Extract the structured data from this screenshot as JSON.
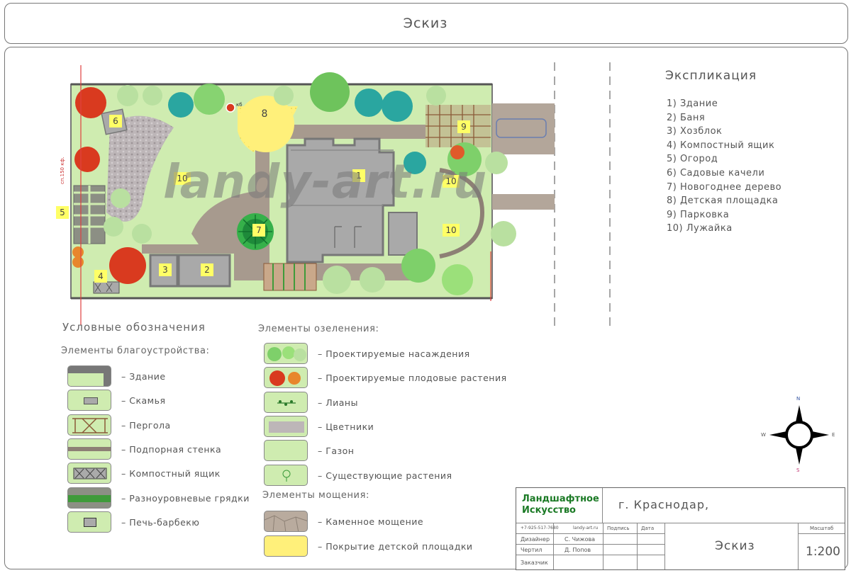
{
  "sheet": {
    "title": "Эскиз"
  },
  "explication": {
    "title": "Экспликация",
    "items": [
      "1) Здание",
      "2) Баня",
      "3) Хозблок",
      "4) Компостный ящик",
      "5) Огород",
      "6) Садовые качели",
      "7) Новогоднее дерево",
      "8) Детская площадка",
      "9) Парковка",
      "10) Лужайка"
    ]
  },
  "plan": {
    "watermark": "landy-art.ru",
    "zone_numbers": [
      "1",
      "2",
      "3",
      "4",
      "5",
      "6",
      "7",
      "8",
      "9",
      "10",
      "10",
      "10"
    ],
    "side_note": "сп.150 кф.",
    "tree_note": "кб"
  },
  "legend": {
    "title": "Условные обозначения",
    "improvement": {
      "title": "Элементы благоустройства:",
      "items": [
        {
          "label": "– Здание",
          "icon": "building-swatch"
        },
        {
          "label": "– Скамья",
          "icon": "bench-swatch"
        },
        {
          "label": "– Пергола",
          "icon": "pergola-swatch"
        },
        {
          "label": "– Подпорная стенка",
          "icon": "retaining-wall-swatch"
        },
        {
          "label": "– Компостный ящик",
          "icon": "compost-box-swatch"
        },
        {
          "label": "– Разноуровневые грядки",
          "icon": "raised-beds-swatch"
        },
        {
          "label": "– Печь-барбекю",
          "icon": "bbq-oven-swatch"
        }
      ]
    },
    "greening": {
      "title": "Элементы озеленения:",
      "items": [
        {
          "label": "– Проектируемые насаждения",
          "icon": "planned-plants-swatch"
        },
        {
          "label": "– Проектируемые плодовые растения",
          "icon": "fruit-plants-swatch"
        },
        {
          "label": "– Лианы",
          "icon": "vines-swatch"
        },
        {
          "label": "– Цветники",
          "icon": "flowerbeds-swatch"
        },
        {
          "label": "– Газон",
          "icon": "lawn-swatch"
        },
        {
          "label": "– Существующие растения",
          "icon": "existing-plants-swatch"
        }
      ]
    },
    "paving": {
      "title": "Элементы мощения:",
      "items": [
        {
          "label": "– Каменное мощение",
          "icon": "stone-paving-swatch"
        },
        {
          "label": "– Покрытие детской площадки",
          "icon": "playground-surface-swatch"
        }
      ]
    }
  },
  "compass": {
    "n": "N",
    "s": "S",
    "e": "E",
    "w": "W"
  },
  "stamp": {
    "logo_line1": "Ландшафтное",
    "logo_line2": "Искусство",
    "city": "г. Краснодар,",
    "phone": "+7-925-517-7680",
    "site": "landy-art.ru",
    "col_signature": "Подпись",
    "col_date": "Дата",
    "col_scale": "Масштаб",
    "designer_role": "Дизайнер",
    "designer_name": "С. Чижова",
    "drafter_role": "Чертил",
    "drafter_name": "Д. Попов",
    "client_role": "Заказчик",
    "sheet_name": "Эскиз",
    "scale": "1:200"
  },
  "colors": {
    "lawn": "#cfecb0",
    "building": "#a9a9a9",
    "paving": "#b3a69a",
    "playground": "#fff07a",
    "tree_green": "#2fa84a",
    "fruit_red": "#d93a1f"
  }
}
